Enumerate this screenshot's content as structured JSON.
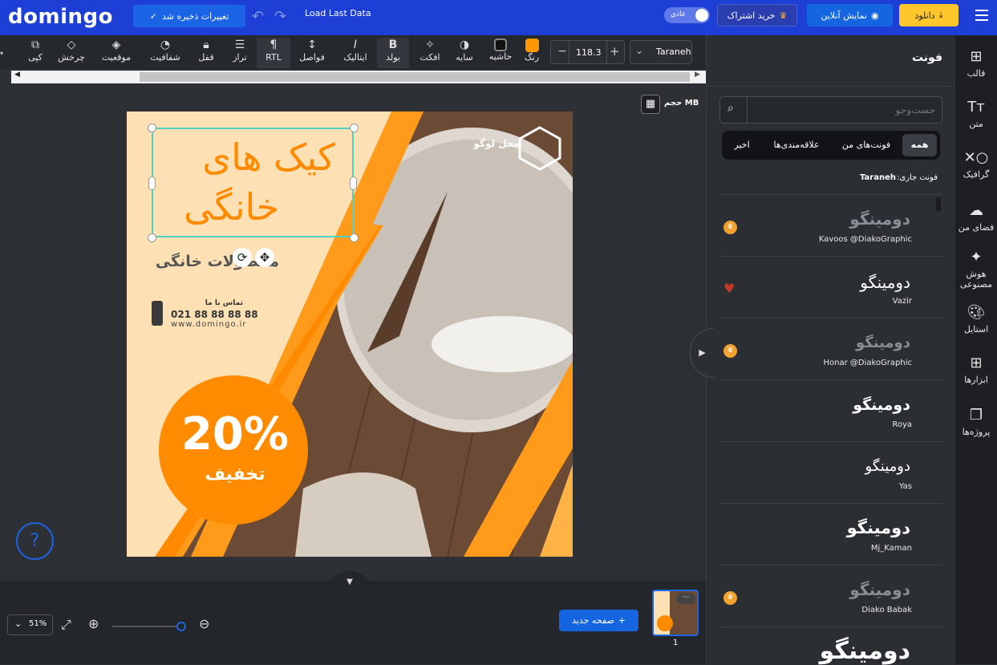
{
  "topbar": {
    "logo": "domingo",
    "save_status": "تغییرات ذخیره شد",
    "load_last": "Load Last Data",
    "mode_label": "عادی",
    "subscribe": "خرید اشتراک",
    "online_preview": "نمایش آنلاین",
    "download": "دانلود"
  },
  "toolbar": {
    "tools": [
      "کپی",
      "چرخش",
      "موقعیت",
      "شفافیت",
      "قفل",
      "تراز",
      "RTL",
      "فواصل",
      "ایتالیک",
      "بولد",
      "افکت",
      "سایه",
      "حاشیه",
      "رنگ"
    ],
    "font_size": "118.3",
    "font_name": "Taraneh",
    "text_color": "#ff9800"
  },
  "canvas": {
    "file_size_label": "حجم MB",
    "headline_line1": "کیک های",
    "headline_line2": "خانگی",
    "subtitle": "محصولات خانگی",
    "contact_label": "تماس با ما",
    "phone": "021 88 88 88 88",
    "website": "www.domingo.ir",
    "logo_text": "محل لوگو",
    "discount_value": "20%",
    "discount_label": "تخفیف",
    "accent_color": "#ff8c00"
  },
  "bottom": {
    "zoom": "51%",
    "new_page": "صفحه جدید",
    "page_number": "1"
  },
  "panel": {
    "title": "فونت",
    "search_placeholder": "جست‌وجو",
    "filters": [
      "همه",
      "فونت‌های من",
      "علاقه‌مندی‌ها",
      "اخیر"
    ],
    "current_font_label": "فونت جاری:",
    "current_font": "Taraneh",
    "fonts": [
      {
        "sample": "دومینگو",
        "name": "Kavoos @DiakoGraphic",
        "badge": "crown"
      },
      {
        "sample": "دومینگو",
        "name": "Vazir",
        "badge": "heart"
      },
      {
        "sample": "دومینگو",
        "name": "Honar @DiakoGraphic",
        "badge": "crown"
      },
      {
        "sample": "دومینگو",
        "name": "Roya",
        "badge": ""
      },
      {
        "sample": "دومینگو",
        "name": "Yas",
        "badge": ""
      },
      {
        "sample": "دومینگو",
        "name": "Mj_Kaman",
        "badge": ""
      },
      {
        "sample": "دومینگو",
        "name": "Diako Babak",
        "badge": "crown"
      },
      {
        "sample": "دومینگو",
        "name": "",
        "badge": ""
      }
    ]
  },
  "sidenav": [
    {
      "label": "قالب",
      "icon": "template-icon"
    },
    {
      "label": "متن",
      "icon": "text-icon"
    },
    {
      "label": "گرافیک",
      "icon": "graphic-icon"
    },
    {
      "label": "فضای من",
      "icon": "upload-icon"
    },
    {
      "label": "هوش مصنوعی",
      "icon": "ai-wand-icon"
    },
    {
      "label": "استایل",
      "icon": "palette-icon"
    },
    {
      "label": "ابزارها",
      "icon": "apps-icon"
    },
    {
      "label": "پروژه‌ها",
      "icon": "projects-icon"
    }
  ]
}
